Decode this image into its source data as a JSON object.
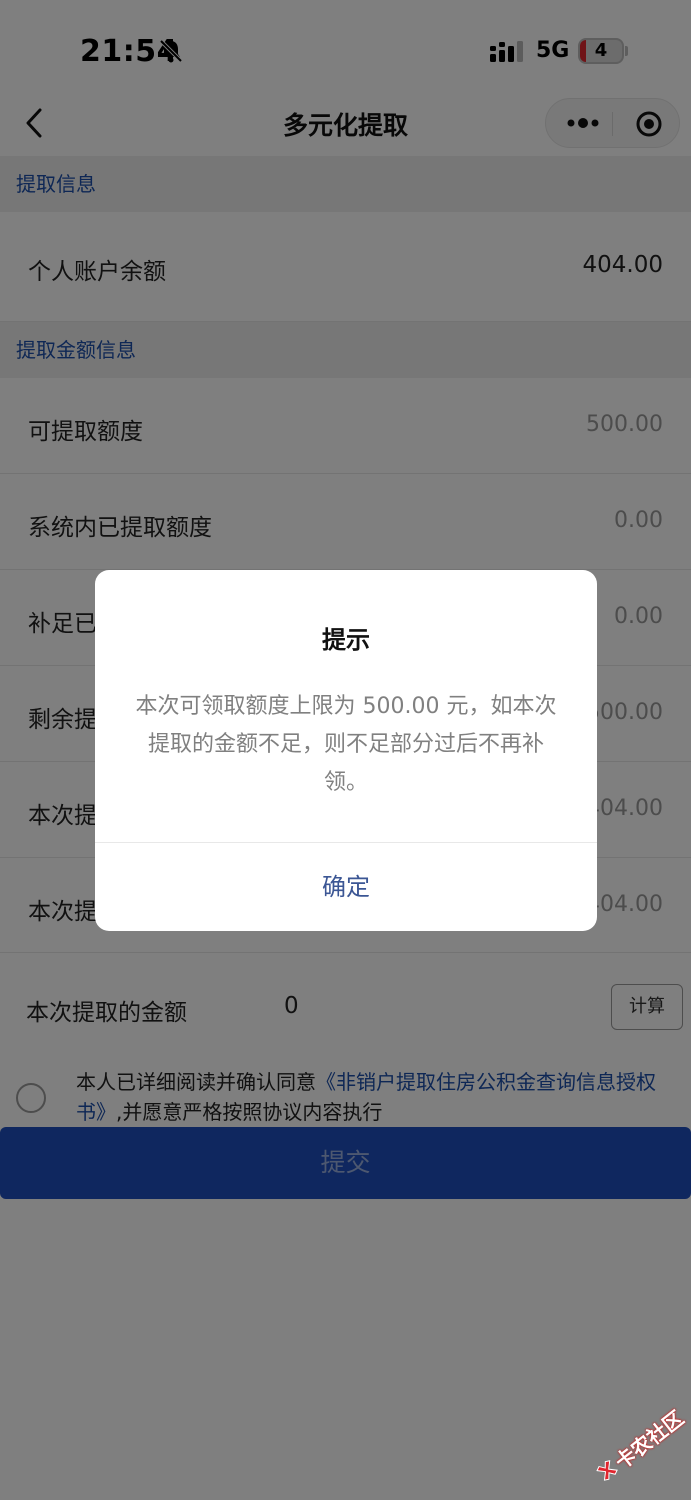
{
  "status_bar": {
    "time": "21:54",
    "network": "5G",
    "battery": "4",
    "battery_color": "#e0262f"
  },
  "nav": {
    "title": "多元化提取",
    "back_icon": "chevron-left-icon",
    "more_icon": "more-dots-icon",
    "close_icon": "target-circle-icon"
  },
  "sections": {
    "info_header": "提取信息",
    "amount_header": "提取金额信息"
  },
  "balance": {
    "label": "个人账户余额",
    "value": "404.00"
  },
  "amount_rows": [
    {
      "label": "可提取额度",
      "value": "500.00"
    },
    {
      "label": "系统内已提取额度",
      "value": "0.00"
    },
    {
      "label": "补足已",
      "value": "0.00"
    },
    {
      "label": "剩余提",
      "value": "500.00"
    },
    {
      "label": "本次提",
      "value": "404.00"
    },
    {
      "label": "本次提",
      "value": "404.00"
    }
  ],
  "current_amount": {
    "label": "本次提取的金额",
    "value": "0",
    "calc_button": "计算"
  },
  "agreement": {
    "prefix": "本人已详细阅读并确认同意",
    "link": "《非销户提取住房公积金查询信息授权书》",
    "suffix": ",并愿意严格按照协议内容执行"
  },
  "submit_label": "提交",
  "dialog": {
    "title": "提示",
    "content": "本次可领取额度上限为 500.00 元，如本次提取的金额不足，则不足部分过后不再补领。",
    "confirm": "确定"
  },
  "watermark": {
    "text": "卡农社区"
  },
  "colors": {
    "accent_blue": "#1d4faa",
    "submit_blue": "#1f4fbe",
    "dialog_button": "#3b5694"
  }
}
